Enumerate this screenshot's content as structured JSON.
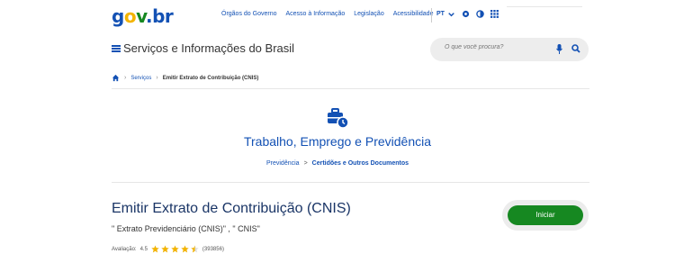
{
  "topbar": {
    "logo": {
      "g": "g",
      "o": "o",
      "v": "v",
      "dot": ".",
      "br": "br"
    },
    "links": [
      "Órgãos do Governo",
      "Acesso à Informação",
      "Legislação",
      "Acessibilidade"
    ],
    "lang": "PT",
    "icons": [
      "chevron-down-icon",
      "contrast-icon",
      "half-circle-icon",
      "apps-grid-icon"
    ]
  },
  "header": {
    "title": "Serviços e Informações do Brasil",
    "search_placeholder": "O que você procura?"
  },
  "breadcrumb": {
    "link": "Serviços",
    "current": "Emitir Extrato de Contribuição (CNIS)"
  },
  "category": {
    "title": "Trabalho, Emprego e Previdência",
    "path_a": "Previdência",
    "sep": ">",
    "path_b": "Certidões e Outros Documentos"
  },
  "service": {
    "title": "Emitir Extrato de Contribuição (CNIS)",
    "subtitle": "\" Extrato Previdenciário (CNIS)\" , \" CNIS\"",
    "rating_label": "Avaliação:",
    "rating_value": "4.5",
    "rating_stars": 4.5,
    "rating_count": "(393856)",
    "start_label": "Iniciar"
  },
  "colors": {
    "primary": "#1351b4",
    "green": "#168821",
    "star": "#f4b400"
  }
}
